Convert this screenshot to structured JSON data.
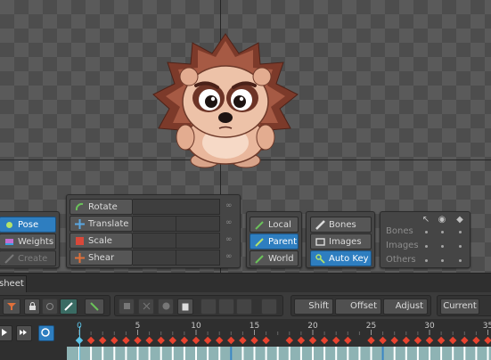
{
  "tools": {
    "mode": {
      "pose": "Pose",
      "weights": "Weights",
      "create": "Create"
    },
    "transform": {
      "rotate": "Rotate",
      "translate": "Translate",
      "scale": "Scale",
      "shear": "Shear"
    },
    "axes": {
      "local": "Local",
      "parent": "Parent",
      "world": "World"
    },
    "selection": {
      "bones": "Bones",
      "images": "Images",
      "auto_key": "Auto Key"
    },
    "visibility": {
      "rows": [
        "Bones",
        "Images",
        "Others"
      ]
    }
  },
  "dopesheet": {
    "tab_label": "sheet",
    "toolbar": {
      "shift": "Shift",
      "offset": "Offset",
      "adjust": "Adjust",
      "current": "Current"
    },
    "ruler": {
      "labels": [
        "0",
        "5",
        "10",
        "15",
        "20",
        "25",
        "30",
        "35"
      ]
    }
  },
  "colors": {
    "accent": "#2e7ec0",
    "key": "#e8432f",
    "current_frame": "#5dc3e6",
    "track": "#8eb3b4"
  }
}
